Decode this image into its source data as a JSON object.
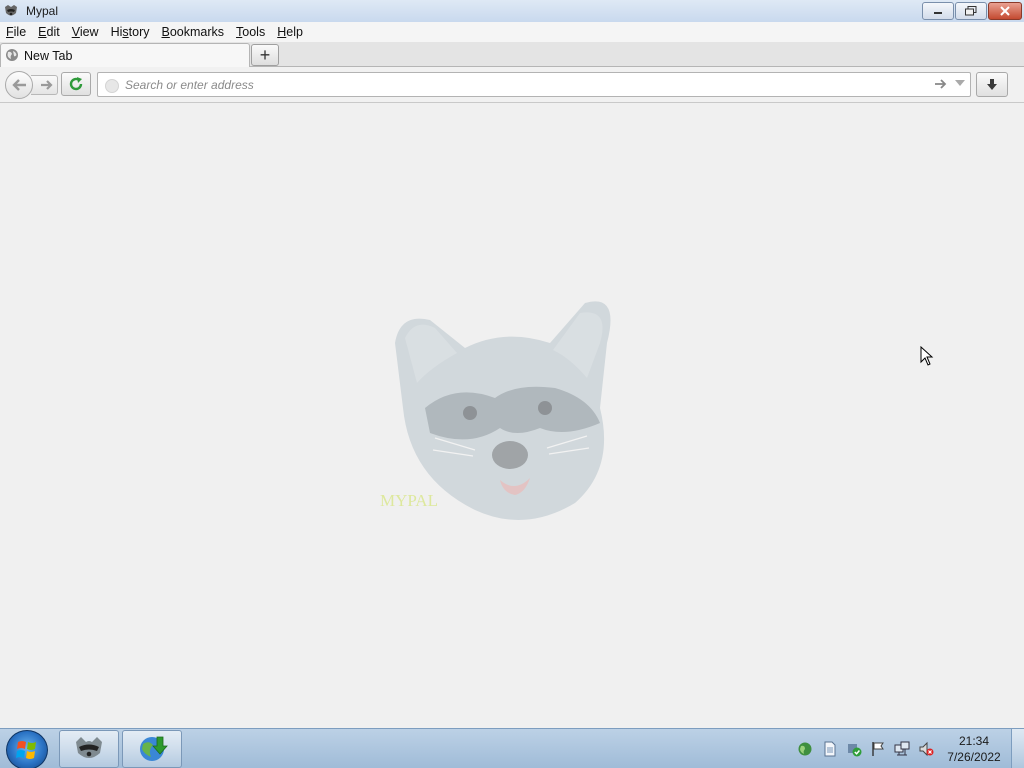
{
  "window": {
    "title": "Mypal",
    "app_icon": "raccoon-icon",
    "controls": [
      "minimize-icon",
      "restore-icon",
      "close-icon"
    ]
  },
  "menu": {
    "items": [
      {
        "label": "File",
        "access_key": "F"
      },
      {
        "label": "Edit",
        "access_key": "E"
      },
      {
        "label": "View",
        "access_key": "V"
      },
      {
        "label": "History",
        "access_key": "s"
      },
      {
        "label": "Bookmarks",
        "access_key": "B"
      },
      {
        "label": "Tools",
        "access_key": "T"
      },
      {
        "label": "Help",
        "access_key": "H"
      }
    ]
  },
  "tabs": {
    "items": [
      {
        "label": "New Tab",
        "icon": "globe-icon",
        "active": true
      }
    ],
    "new_tab_label": "+"
  },
  "navigation": {
    "back_icon": "back-arrow-icon",
    "forward_icon": "forward-arrow-icon",
    "reload_icon": "reload-icon",
    "address": {
      "value": "",
      "placeholder": "Search or enter address",
      "go_icon": "go-arrow-icon",
      "dropdown_icon": "dropdown-icon"
    },
    "download_icon": "download-icon"
  },
  "content": {
    "logo": "mypal-raccoon-logo",
    "logo_text": "MYPAL"
  },
  "taskbar": {
    "start_icon": "windows-start-icon",
    "apps": [
      {
        "icon": "mypal-raccoon-icon"
      },
      {
        "icon": "download-manager-icon"
      }
    ],
    "tray_icons": [
      "network-globe-icon",
      "document-icon",
      "security-check-icon",
      "action-center-flag-icon",
      "network-icon",
      "volume-muted-icon"
    ],
    "clock": {
      "time": "21:34",
      "date": "7/26/2022"
    }
  },
  "colors": {
    "accent": "#3b7fd1",
    "reload_green": "#2e9a3a",
    "close_red": "#c44a31"
  }
}
